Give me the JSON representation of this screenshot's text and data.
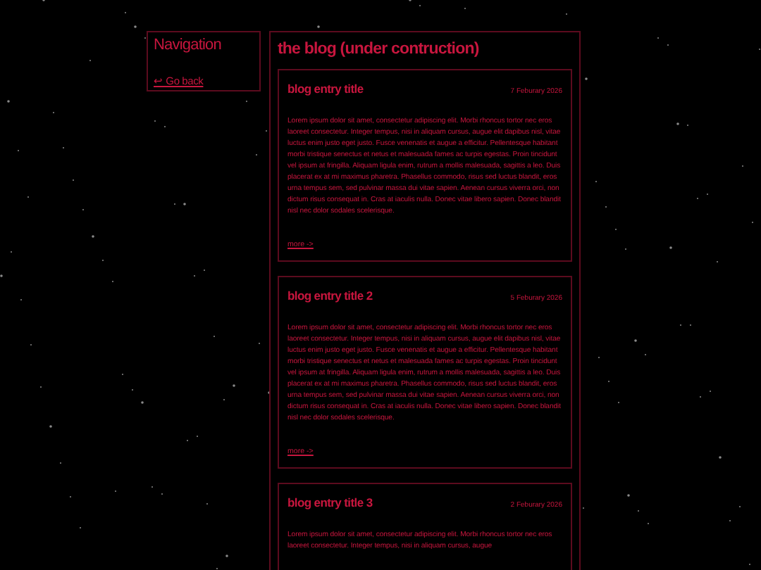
{
  "navigation": {
    "title": "Navigation",
    "links": [
      {
        "label": "↩ Go back"
      }
    ]
  },
  "blog": {
    "title": "the blog (under contruction)",
    "entries": [
      {
        "title": "blog entry title",
        "date": "7 Feburary 2026",
        "body": "Lorem ipsum dolor sit amet, consectetur adipiscing elit. Morbi rhoncus tortor nec eros laoreet consectetur. Integer tempus, nisi in aliquam cursus, augue elit dapibus nisl, vitae luctus enim justo eget justo. Fusce venenatis et augue a efficitur. Pellentesque habitant morbi tristique senectus et netus et malesuada fames ac turpis egestas. Proin tincidunt vel ipsum at fringilla. Aliquam ligula enim, rutrum a mollis malesuada, sagittis a leo. Duis placerat ex at mi maximus pharetra. Phasellus commodo, risus sed luctus blandit, eros urna tempus sem, sed pulvinar massa dui vitae sapien. Aenean cursus viverra orci, non dictum risus consequat in. Cras at iaculis nulla. Donec vitae libero sapien. Donec blandit nisl nec dolor sodales scelerisque.",
        "more": "more ->"
      },
      {
        "title": "blog entry title 2",
        "date": "5 Feburary 2026",
        "body": "Lorem ipsum dolor sit amet, consectetur adipiscing elit. Morbi rhoncus tortor nec eros laoreet consectetur. Integer tempus, nisi in aliquam cursus, augue elit dapibus nisl, vitae luctus enim justo eget justo. Fusce venenatis et augue a efficitur. Pellentesque habitant morbi tristique senectus et netus et malesuada fames ac turpis egestas. Proin tincidunt vel ipsum at fringilla. Aliquam ligula enim, rutrum a mollis malesuada, sagittis a leo. Duis placerat ex at mi maximus pharetra. Phasellus commodo, risus sed luctus blandit, eros urna tempus sem, sed pulvinar massa dui vitae sapien. Aenean cursus viverra orci, non dictum risus consequat in. Cras at iaculis nulla. Donec vitae libero sapien. Donec blandit nisl nec dolor sodales scelerisque.",
        "more": "more ->"
      },
      {
        "title": "blog entry title 3",
        "date": "2 Feburary 2026",
        "body": "Lorem ipsum dolor sit amet, consectetur adipiscing elit. Morbi rhoncus tortor nec eros laoreet consectetur. Integer tempus, nisi in aliquam cursus, augue"
      }
    ]
  }
}
